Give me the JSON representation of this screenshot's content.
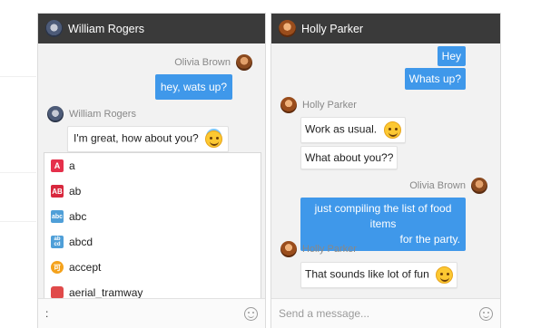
{
  "windows": [
    {
      "header": {
        "name": "William Rogers"
      },
      "messages": [
        {
          "sender": "Olivia Brown",
          "text": "hey, wats up?"
        },
        {
          "sender": "William Rogers",
          "text": "I'm great, how about you?"
        }
      ],
      "autocomplete": [
        {
          "label": "a",
          "icon": "a-button-icon"
        },
        {
          "label": "ab",
          "icon": "ab-button-icon"
        },
        {
          "label": "abc",
          "icon": "abc-icon"
        },
        {
          "label": "abcd",
          "icon": "abcd-icon"
        },
        {
          "label": "accept",
          "icon": "accept-icon"
        },
        {
          "label": "aerial_tramway",
          "icon": "aerial-tramway-icon"
        }
      ],
      "input": {
        "value": ":",
        "placeholder": ""
      }
    },
    {
      "header": {
        "name": "Holly Parker"
      },
      "messages": [
        {
          "sender": "",
          "text": "Hey"
        },
        {
          "sender": "",
          "text": "Whats up?"
        },
        {
          "sender": "Holly Parker",
          "text": "Work as usual."
        },
        {
          "sender": "",
          "text": "What about you??"
        },
        {
          "sender": "Olivia Brown",
          "text": "just compiling the list of food items"
        },
        {
          "sender": "",
          "text": "for the party."
        },
        {
          "sender": "Holly Parker",
          "text": "That sounds like lot of fun"
        }
      ],
      "input": {
        "value": "",
        "placeholder": "Send a message..."
      }
    }
  ],
  "colors": {
    "header_bg": "#3a3a3a",
    "outgoing_bubble": "#3f98ea",
    "incoming_bubble": "#ffffff",
    "panel_bg": "#f2f2f2"
  }
}
